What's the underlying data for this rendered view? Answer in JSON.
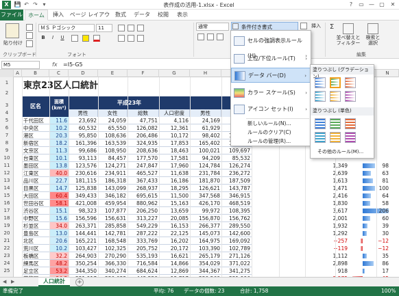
{
  "titlebar": {
    "title": "表作成の活用-1.xlsx - Excel",
    "app_icon": "X",
    "quick_access": [
      "💾",
      "↶",
      "↷",
      "▾"
    ],
    "win_buttons": [
      "?",
      "▭",
      "—",
      "▢",
      "✕"
    ]
  },
  "tabs": [
    {
      "name": "file",
      "label": "ファイル"
    },
    {
      "name": "home",
      "label": "ホーム"
    },
    {
      "name": "insert",
      "label": "挿入"
    },
    {
      "name": "layout",
      "label": "ページ レイアウト"
    },
    {
      "name": "formulas",
      "label": "数式"
    },
    {
      "name": "data",
      "label": "データ"
    },
    {
      "name": "review",
      "label": "校閲"
    },
    {
      "name": "view",
      "label": "表示"
    }
  ],
  "ribbon": {
    "paste_label": "貼り付け",
    "clipboard_label": "クリップボード",
    "font_name": "ＭＳ Ｐゴシック",
    "font_size": "11",
    "font_label": "フォント",
    "number_format": "通常",
    "cond_format_label": "条件付き書式",
    "insert_label": "挿入",
    "sum_label": "Σ",
    "sort_filter_label": "並べ替えと\nフィルター",
    "find_label": "検索と\n選択",
    "edit_label": "編集",
    "bold": "B",
    "italic": "I",
    "underline": "U"
  },
  "formula": {
    "namebox": "M5",
    "fx": "fx",
    "content": "=I5-G5"
  },
  "columns": [
    "A",
    "B",
    "C",
    "D",
    "E",
    "F",
    "G",
    "H",
    "I",
    "J",
    "K",
    "L",
    "M",
    "N"
  ],
  "rows": [
    "1",
    "2",
    "3",
    "4",
    "5",
    "6",
    "7",
    "8",
    "9",
    "10",
    "11",
    "12",
    "13",
    "14",
    "15",
    "16",
    "17",
    "18",
    "19",
    "20",
    "21",
    "22",
    "23",
    "24",
    "25",
    "26",
    "27"
  ],
  "sheet": {
    "title": "東京23区人口統計",
    "header": {
      "ward": "区名",
      "area": "面積\n(km²)",
      "year": "平成23年",
      "male": "男性",
      "female": "女性",
      "total": "総数",
      "density": "人口密度",
      "male2": "男性",
      "female2": "女性"
    },
    "data": [
      [
        "千代田区",
        "11.6",
        "23,692",
        "24,059",
        "47,751",
        "4,116",
        "24,169",
        "24,420"
      ],
      [
        "中央区",
        "10.2",
        "60,532",
        "65,550",
        "126,082",
        "12,361",
        "61,929",
        "67,264"
      ],
      [
        "港区",
        "20.3",
        "95,850",
        "108,636",
        "206,486",
        "10,172",
        "98,402",
        "113,258"
      ],
      [
        "新宿区",
        "18.2",
        "161,396",
        "163,539",
        "324,935",
        "17,853",
        "165,402",
        "167,231"
      ],
      [
        "文京区",
        "11.3",
        "99,686",
        "108,950",
        "208,636",
        "18,463",
        "100,021",
        "109,697"
      ],
      [
        "台東区",
        "10.1",
        "93,113",
        "84,457",
        "177,570",
        "17,581",
        "94,209",
        "85,532"
      ],
      [
        "墨田区",
        "13.8",
        "123,576",
        "124,271",
        "247,847",
        "17,960",
        "124,784",
        "126,274"
      ],
      [
        "江東区",
        "40.0",
        "230,616",
        "234,911",
        "465,527",
        "11,638",
        "231,784",
        "236,272"
      ],
      [
        "品川区",
        "22.7",
        "181,115",
        "186,318",
        "367,433",
        "16,186",
        "181,870",
        "187,509"
      ],
      [
        "目黒区",
        "14.7",
        "125,838",
        "143,099",
        "268,937",
        "18,295",
        "126,621",
        "143,787"
      ],
      [
        "大田区",
        "60.4",
        "349,433",
        "346,182",
        "695,615",
        "11,500",
        "347,568",
        "346,915"
      ],
      [
        "世田谷区",
        "58.1",
        "421,008",
        "459,954",
        "880,962",
        "15,163",
        "426,170",
        "468,519"
      ],
      [
        "渋谷区",
        "15.1",
        "98,323",
        "107,877",
        "206,250",
        "13,659",
        "99,972",
        "108,395"
      ],
      [
        "中野区",
        "15.6",
        "156,596",
        "156,631",
        "313,227",
        "20,085",
        "156,870",
        "156,762"
      ],
      [
        "杉並区",
        "34.0",
        "263,371",
        "285,858",
        "549,229",
        "16,153",
        "266,377",
        "289,550"
      ],
      [
        "豊島区",
        "13.0",
        "144,441",
        "142,781",
        "287,222",
        "22,125",
        "145,073",
        "142,600"
      ],
      [
        "北区",
        "20.6",
        "165,221",
        "168,548",
        "333,769",
        "16,202",
        "164,975",
        "169,092"
      ],
      [
        "荒川区",
        "10.2",
        "103,427",
        "102,325",
        "205,752",
        "20,172",
        "103,390",
        "102,789"
      ],
      [
        "板橋区",
        "32.2",
        "264,903",
        "270,290",
        "535,193",
        "16,621",
        "265,179",
        "271,126"
      ],
      [
        "練馬区",
        "48.2",
        "350,254",
        "366,330",
        "716,584",
        "14,866",
        "354,029",
        "371,022"
      ],
      [
        "足立区",
        "53.2",
        "344,350",
        "340,274",
        "684,624",
        "12,869",
        "344,367",
        "341,275"
      ],
      [
        "葛飾区",
        "34.8",
        "221,917",
        "220,633",
        "442,550",
        "12,717",
        "220,560",
        "221,996"
      ],
      [
        "江戸川区",
        "49.9",
        "339,494",
        "338,566",
        "678,060",
        "13,588",
        "340,131",
        "339,446"
      ]
    ],
    "right_vals": [
      [
        "1,349",
        "98"
      ],
      [
        "2,639",
        "63"
      ],
      [
        "1,613",
        "81"
      ],
      [
        "1,471",
        "100"
      ],
      [
        "2,416",
        "64"
      ],
      [
        "1,830",
        "58"
      ],
      [
        "3,617",
        "206"
      ],
      [
        "2,001",
        "60"
      ],
      [
        "1,932",
        "39"
      ],
      [
        "1,292",
        "30"
      ],
      [
        "−257",
        "−12"
      ],
      [
        "−119",
        "−12"
      ],
      [
        "1,112",
        "35"
      ],
      [
        "2,898",
        "86"
      ],
      [
        "918",
        "17"
      ],
      [
        "−2,275",
        "−65"
      ],
      [
        "−3,778",
        "−76"
      ]
    ]
  },
  "cond_menu": {
    "items": [
      {
        "name": "highlight-rules",
        "label": "セルの強調表示ルール(H)"
      },
      {
        "name": "top-bottom-rules",
        "label": "上位/下位ルール(T)"
      },
      {
        "name": "data-bar",
        "label": "データ バー(D)"
      },
      {
        "name": "color-scale",
        "label": "カラー スケール(S)"
      },
      {
        "name": "icon-set",
        "label": "アイコン セット(I)"
      },
      {
        "name": "new-rule",
        "label": "新しいルール(N)..."
      },
      {
        "name": "clear-rules",
        "label": "ルールのクリア(C)"
      },
      {
        "name": "manage-rules",
        "label": "ルールの管理(R)..."
      }
    ]
  },
  "databar_menu": {
    "gradient_label": "塗りつぶし (グラデーション)",
    "solid_label": "塗りつぶし (単色)",
    "more_label": "その他のルール(M)..."
  },
  "sheet_tabs": {
    "active": "人口統計",
    "add": "+"
  },
  "status": {
    "ready": "準備完了",
    "avg": "平均: 76",
    "count": "データの個数: 23",
    "sum": "合計: 1,758",
    "zoom": "100%"
  },
  "colors": {
    "excel_green": "#217346",
    "header_navy": "#1f3a6b",
    "databar_blue": "#2f79d6",
    "databar_red": "#e03a3a"
  }
}
